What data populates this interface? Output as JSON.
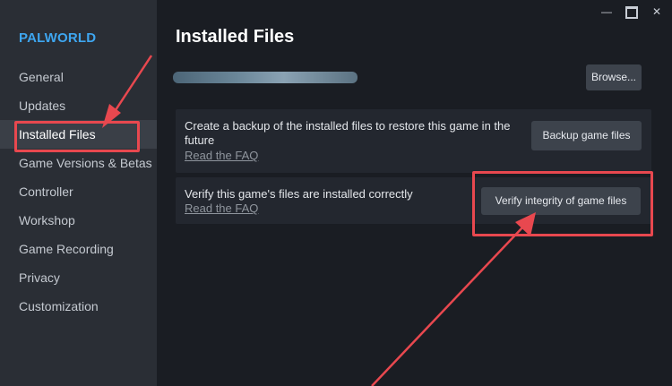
{
  "sidebar": {
    "game_title": "PALWORLD",
    "items": [
      {
        "label": "General"
      },
      {
        "label": "Updates"
      },
      {
        "label": "Installed Files",
        "active": true
      },
      {
        "label": "Game Versions & Betas"
      },
      {
        "label": "Controller"
      },
      {
        "label": "Workshop"
      },
      {
        "label": "Game Recording"
      },
      {
        "label": "Privacy"
      },
      {
        "label": "Customization"
      }
    ]
  },
  "window_controls": [
    "minimize-icon",
    "maximize-icon",
    "close-icon"
  ],
  "main": {
    "title": "Installed Files",
    "browse_label": "Browse...",
    "backup_panel": {
      "text": "Create a backup of the installed files to restore this game in the future",
      "faq": "Read the FAQ",
      "button": "Backup game files"
    },
    "verify_panel": {
      "text": "Verify this game's files are installed correctly",
      "faq": "Read the FAQ",
      "button": "Verify integrity of game files"
    }
  },
  "colors": {
    "accent": "#3ea6f0",
    "highlight": "#e8484f",
    "background": "#1a1d23",
    "sidebar": "#2a2e35"
  }
}
